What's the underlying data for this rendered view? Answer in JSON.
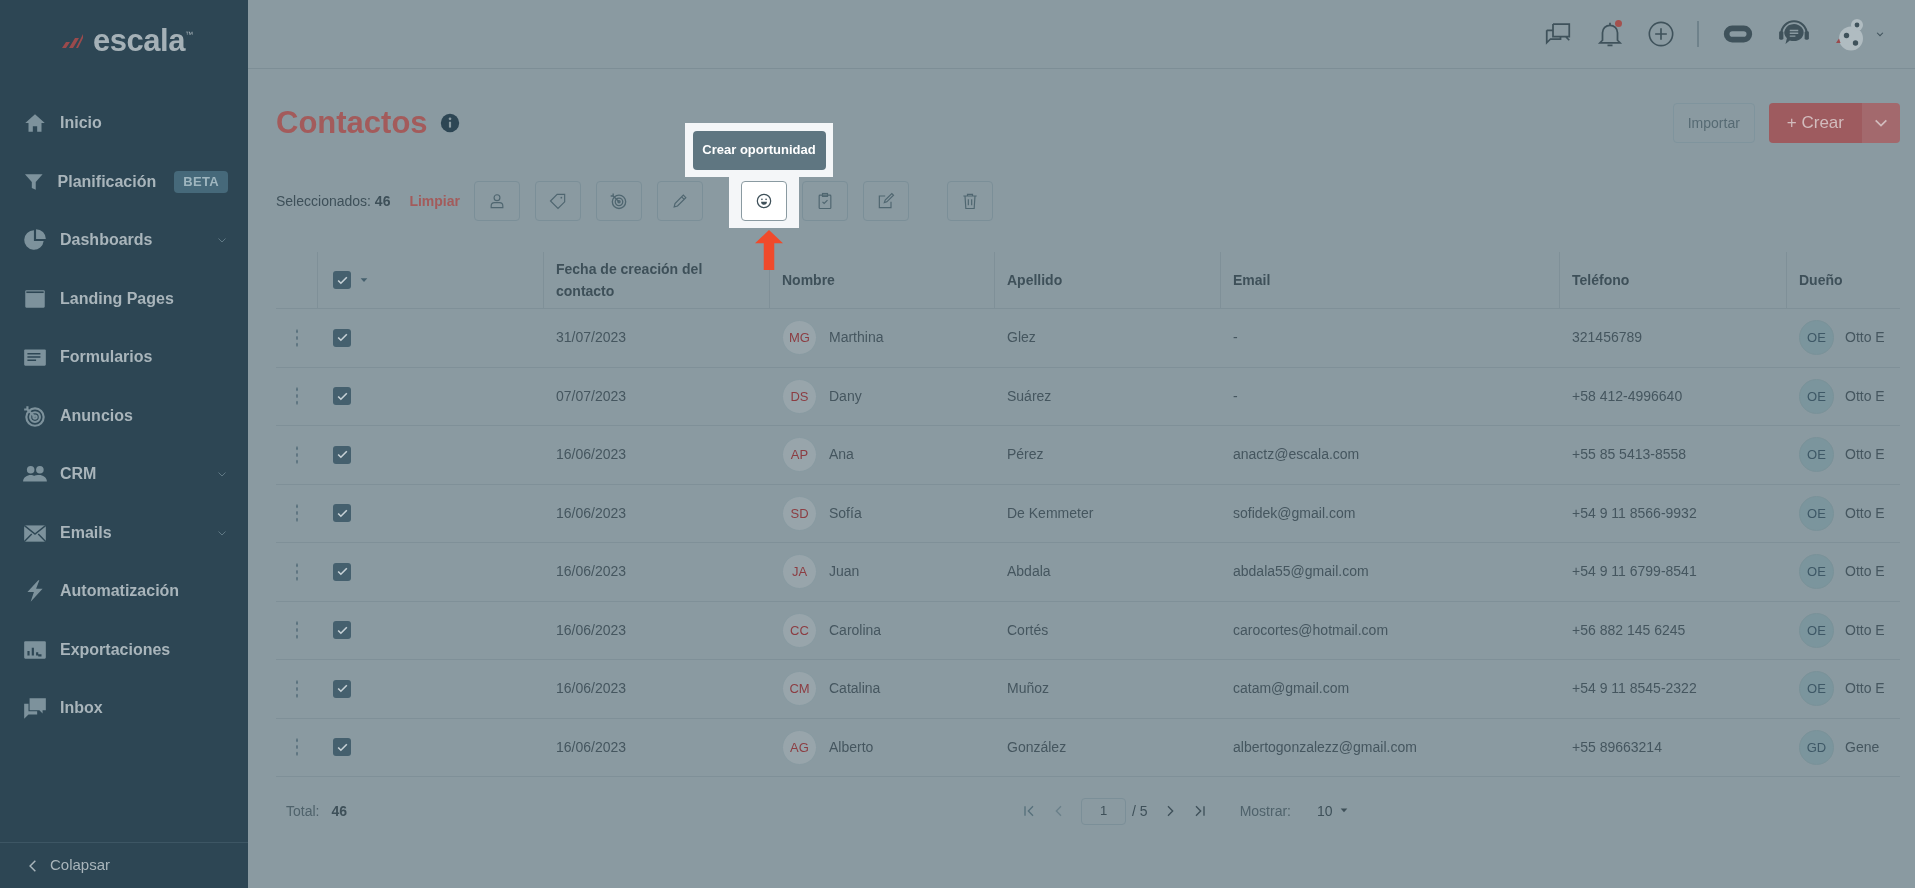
{
  "sidebar": {
    "logo": {
      "name": "escala",
      "mark": "™"
    },
    "items": [
      {
        "label": "Inicio",
        "expandable": false
      },
      {
        "label": "Planificación",
        "badge": "BETA",
        "expandable": false
      },
      {
        "label": "Dashboards",
        "expandable": true
      },
      {
        "label": "Landing Pages",
        "expandable": false
      },
      {
        "label": "Formularios",
        "expandable": false
      },
      {
        "label": "Anuncios",
        "expandable": false
      },
      {
        "label": "CRM",
        "expandable": true
      },
      {
        "label": "Emails",
        "expandable": true
      },
      {
        "label": "Automatización",
        "expandable": false
      },
      {
        "label": "Exportaciones",
        "expandable": false
      },
      {
        "label": "Inbox",
        "expandable": false
      }
    ],
    "collapse": "Colapsar"
  },
  "topbar": {
    "notifications_unread": true
  },
  "page": {
    "title": "Contactos",
    "import_button": "Importar",
    "create_button": "+ Crear"
  },
  "toolbar": {
    "selected_label": "Seleccionados:",
    "selected_count": "46",
    "clear": "Limpiar",
    "tooltip": "Crear oportunidad",
    "groups": [
      [
        {
          "highlighted": false
        },
        {
          "highlighted": false
        },
        {
          "highlighted": false
        },
        {
          "highlighted": false
        }
      ],
      [
        {
          "highlighted": true
        },
        {
          "highlighted": false
        },
        {
          "highlighted": false
        }
      ],
      [
        {
          "highlighted": false
        }
      ]
    ]
  },
  "table": {
    "all_checked": true,
    "columns": [
      "Fecha de creación del contacto",
      "Nombre",
      "Apellido",
      "Email",
      "Teléfono",
      "Dueño"
    ],
    "rows": [
      {
        "checked": true,
        "date": "31/07/2023",
        "initials": "MG",
        "first": "Marthina",
        "last": "Glez",
        "email": "-",
        "phone": "321456789",
        "owner_initials": "OE",
        "owner": "Otto E"
      },
      {
        "checked": true,
        "date": "07/07/2023",
        "initials": "DS",
        "first": "Dany",
        "last": "Suárez",
        "email": "-",
        "phone": "+58 412-4996640",
        "owner_initials": "OE",
        "owner": "Otto E"
      },
      {
        "checked": true,
        "date": "16/06/2023",
        "initials": "AP",
        "first": "Ana",
        "last": "Pérez",
        "email": "anactz@escala.com",
        "phone": "+55 85 5413-8558",
        "owner_initials": "OE",
        "owner": "Otto E"
      },
      {
        "checked": true,
        "date": "16/06/2023",
        "initials": "SD",
        "first": "Sofía",
        "last": "De Kemmeter",
        "email": "sofidek@gmail.com",
        "phone": "+54 9 11 8566-9932",
        "owner_initials": "OE",
        "owner": "Otto E"
      },
      {
        "checked": true,
        "date": "16/06/2023",
        "initials": "JA",
        "first": "Juan",
        "last": "Abdala",
        "email": "abdala55@gmail.com",
        "phone": "+54 9 11 6799-8541",
        "owner_initials": "OE",
        "owner": "Otto E"
      },
      {
        "checked": true,
        "date": "16/06/2023",
        "initials": "CC",
        "first": "Carolina",
        "last": "Cortés",
        "email": "carocortes@hotmail.com",
        "phone": "+56 882 145 6245",
        "owner_initials": "OE",
        "owner": "Otto E"
      },
      {
        "checked": true,
        "date": "16/06/2023",
        "initials": "CM",
        "first": "Catalina",
        "last": "Muñoz",
        "email": "catam@gmail.com",
        "phone": "+54 9 11 8545-2322",
        "owner_initials": "OE",
        "owner": "Otto E"
      },
      {
        "checked": true,
        "date": "16/06/2023",
        "initials": "AG",
        "first": "Alberto",
        "last": "González",
        "email": "albertogonzalezz@gmail.com",
        "phone": "+55 89663214",
        "owner_initials": "GD",
        "owner": "Gene"
      }
    ]
  },
  "footer": {
    "total_label": "Total:",
    "total": "46",
    "page": "1",
    "pages": "/ 5",
    "show_label": "Mostrar:",
    "page_size": "10"
  }
}
